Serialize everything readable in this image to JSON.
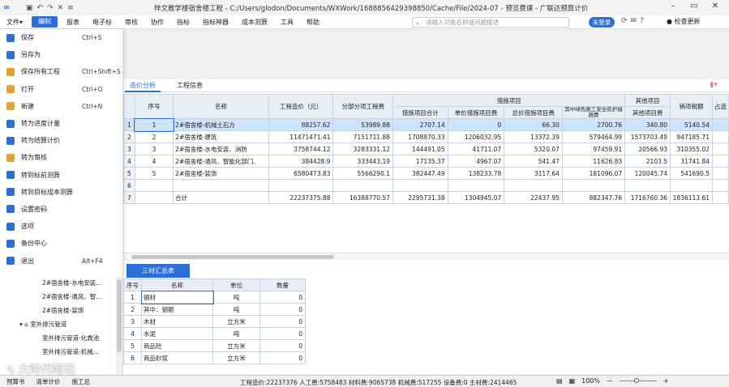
{
  "titlebar": {
    "title": "梓文教学楼宿舍楼工程 - C:/Users/glodon/Documents/WXWork/1688856429398850/Cache/File/2024-07 - 预览费课 - 广联达预算计价"
  },
  "menu": {
    "items": [
      "文件▾",
      "编制",
      "报表",
      "电子标",
      "审核",
      "协作",
      "指标",
      "指标神器",
      "成本测算",
      "工具",
      "帮助"
    ],
    "active_index": 1
  },
  "search": {
    "placeholder": "请输入功能名称或问题描述"
  },
  "header_right": {
    "login": "未登录",
    "update": "检查更新"
  },
  "side_menu": {
    "items": [
      {
        "label": "保存",
        "shortcut": "Ctrl+S",
        "icon": "save-icon",
        "color": "#2b6ed8"
      },
      {
        "label": "另存为",
        "shortcut": "",
        "icon": "save-as-icon",
        "color": "#2b6ed8"
      },
      {
        "label": "保存所有工程",
        "shortcut": "Ctrl+Shift+S",
        "icon": "save-all-icon",
        "color": "#e0a030"
      },
      {
        "label": "打开",
        "shortcut": "Ctrl+O",
        "icon": "folder-icon",
        "color": "#e8a030"
      },
      {
        "label": "新建",
        "shortcut": "Ctrl+N",
        "icon": "new-file-icon",
        "color": "#e8a030"
      },
      {
        "label": "转为进度计量",
        "shortcut": "",
        "icon": "convert-progress-icon",
        "color": "#2b6ed8"
      },
      {
        "label": "转为结算计价",
        "shortcut": "",
        "icon": "convert-settlement-icon",
        "color": "#2b6ed8"
      },
      {
        "label": "转为审核",
        "shortcut": "",
        "icon": "convert-audit-icon",
        "color": "#e8a030"
      },
      {
        "label": "转到标前测算",
        "shortcut": "",
        "icon": "pre-bid-icon",
        "color": "#2b6ed8"
      },
      {
        "label": "转到目标成本测算",
        "shortcut": "",
        "icon": "target-cost-icon",
        "color": "#2b6ed8"
      },
      {
        "label": "设置密码",
        "shortcut": "",
        "icon": "lock-icon",
        "color": "#2b6ed8"
      },
      {
        "label": "选项",
        "shortcut": "",
        "icon": "options-icon",
        "color": "#2b6ed8"
      },
      {
        "label": "备份中心",
        "shortcut": "",
        "icon": "backup-icon",
        "color": "#2b6ed8"
      },
      {
        "label": "退出",
        "shortcut": "Alt+F4",
        "icon": "power-icon",
        "color": "#2b6ed8"
      }
    ]
  },
  "tree": {
    "items": [
      {
        "label": "2#宿舍楼-水电安装...",
        "indent": 2
      },
      {
        "label": "2#宿舍楼-通风、智...",
        "indent": 2
      },
      {
        "label": "2#宿舍楼-装饰",
        "indent": 2
      },
      {
        "label": "▾ ⌂ 室外排污管道",
        "indent": 1
      },
      {
        "label": "室外排污管道-化粪池",
        "indent": 2
      },
      {
        "label": "室外排污管道-机械...",
        "indent": 2
      }
    ]
  },
  "tabs": [
    "造价分析",
    "工程信息"
  ],
  "main_table": {
    "headers": {
      "seq": "序号",
      "name": "名称",
      "total": "工程造价（元）",
      "fenbu": "分部分项工程费",
      "measure_group": "措施项目",
      "measure_total": "措施项目合计",
      "unit_measure": "单价措施项目费",
      "total_measure": "总价措施项目费",
      "safety": "其中绿色施工安全防护措施费",
      "other_group": "其他项目",
      "other_fee": "其他项目费",
      "tax": "销项税额",
      "ratio": "占造"
    },
    "rows": [
      {
        "rn": "1",
        "seq": "1",
        "name": "2#宿舍楼-机械土石方",
        "total": "88257.62",
        "fenbu": "53989.88",
        "measure_total": "2707.14",
        "unit_measure": "0",
        "total_measure": "66.30",
        "safety": "2700.76",
        "other_fee": "340.80",
        "tax": "5140.54"
      },
      {
        "rn": "2",
        "seq": "2",
        "name": "2#宿舍楼-建筑",
        "total": "11471471.41",
        "fenbu": "7151711.88",
        "measure_total": "1708870.33",
        "unit_measure": "1206032.95",
        "total_measure": "13372.39",
        "safety": "579464.99",
        "other_fee": "1573703.49",
        "tax": "947185.71"
      },
      {
        "rn": "3",
        "seq": "3",
        "name": "2#宿舍楼-水电安装、消防",
        "total": "3758744.12",
        "fenbu": "3283331.12",
        "measure_total": "144491.05",
        "unit_measure": "41711.07",
        "total_measure": "5320.07",
        "safety": "97459.91",
        "other_fee": "20566.93",
        "tax": "310355.02"
      },
      {
        "rn": "4",
        "seq": "4",
        "name": "2#宿舍楼-通风、智能化部门、",
        "total": "384428.9",
        "fenbu": "333443.19",
        "measure_total": "17135.37",
        "unit_measure": "4967.07",
        "total_measure": "541.47",
        "safety": "11626.83",
        "other_fee": "2103.5",
        "tax": "31741.84"
      },
      {
        "rn": "5",
        "seq": "5",
        "name": "2#宿舍楼-装饰",
        "total": "6580473.83",
        "fenbu": "5566290.1",
        "measure_total": "382447.49",
        "unit_measure": "138233.78",
        "total_measure": "3117.64",
        "safety": "181096.07",
        "other_fee": "120045.74",
        "tax": "541690.5"
      },
      {
        "rn": "6",
        "seq": "",
        "name": "",
        "total": "",
        "fenbu": "",
        "measure_total": "",
        "unit_measure": "",
        "total_measure": "",
        "safety": "",
        "other_fee": "",
        "tax": ""
      },
      {
        "rn": "7",
        "seq": "",
        "name": "合计",
        "total": "22237375.88",
        "fenbu": "16388770.57",
        "measure_total": "2295731.38",
        "unit_measure": "1304945.07",
        "total_measure": "22437.95",
        "safety": "882347.76",
        "other_fee": "1716760.36",
        "tax": "1836113.61"
      }
    ],
    "selected_row": 0
  },
  "bottom": {
    "tab": "三材汇总表",
    "headers": {
      "seq": "序号",
      "name": "名称",
      "unit": "单位",
      "qty": "数量"
    },
    "rows": [
      {
        "seq": "1",
        "name": "钢材",
        "unit": "吨",
        "qty": "0"
      },
      {
        "seq": "2",
        "name": "其中：钢筋",
        "unit": "吨",
        "qty": "0"
      },
      {
        "seq": "3",
        "name": "木材",
        "unit": "立方米",
        "qty": "0"
      },
      {
        "seq": "4",
        "name": "水泥",
        "unit": "吨",
        "qty": "0"
      },
      {
        "seq": "5",
        "name": "商品砼",
        "unit": "立方米",
        "qty": "0"
      },
      {
        "seq": "6",
        "name": "商品砂浆",
        "unit": "立方米",
        "qty": "0"
      }
    ]
  },
  "statusbar": {
    "tabs": [
      "预算书",
      "清单计价",
      "施工总"
    ],
    "info": "工程造价:22237376  人工费:5758483  材料费:9065738  机械费:517255  设备费:0  主材费:2414465",
    "zoom": "100%"
  },
  "watermark": {
    "text": "大时代笔记"
  }
}
